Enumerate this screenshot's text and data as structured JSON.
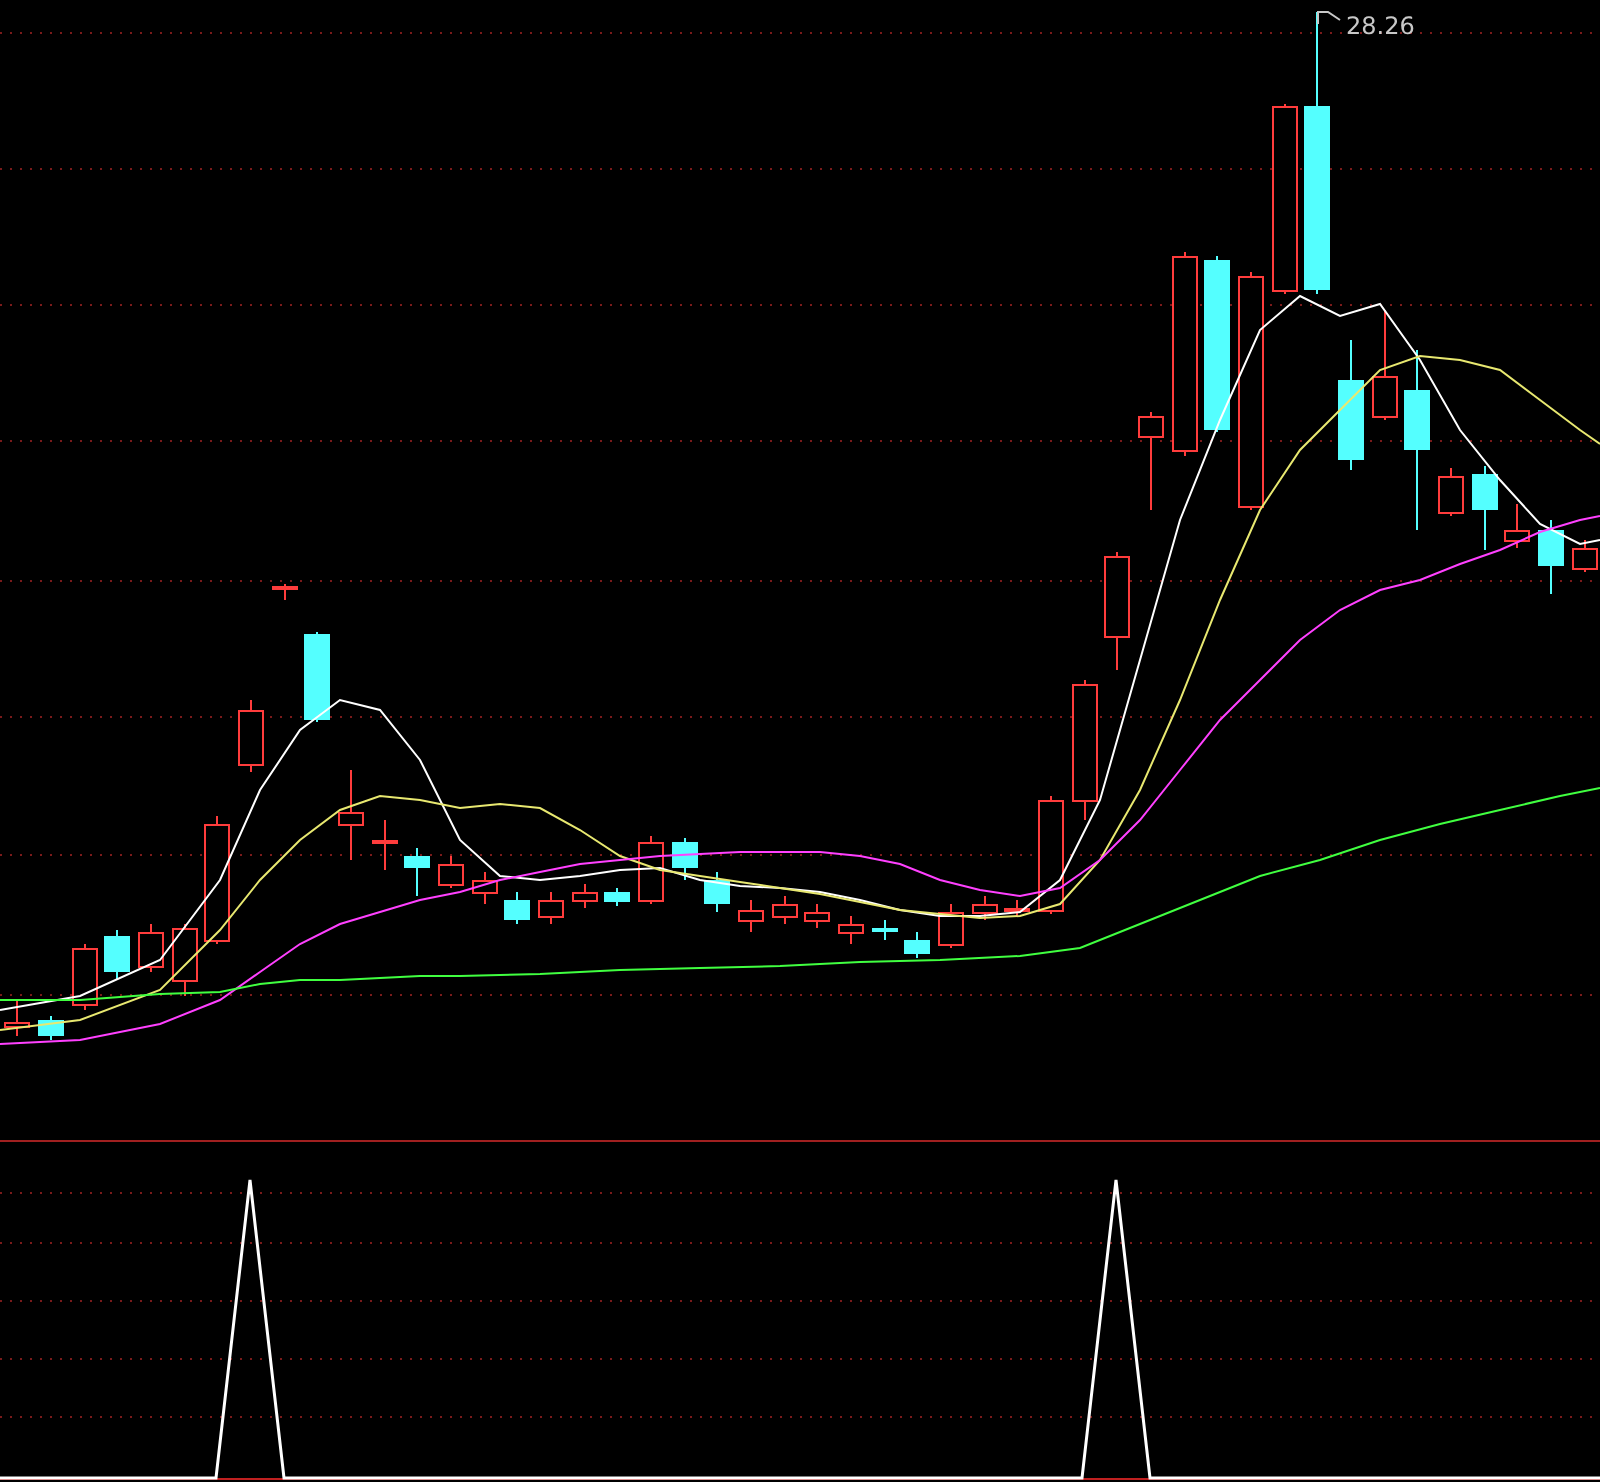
{
  "price_chart": {
    "high_label": "28.26"
  }
}
